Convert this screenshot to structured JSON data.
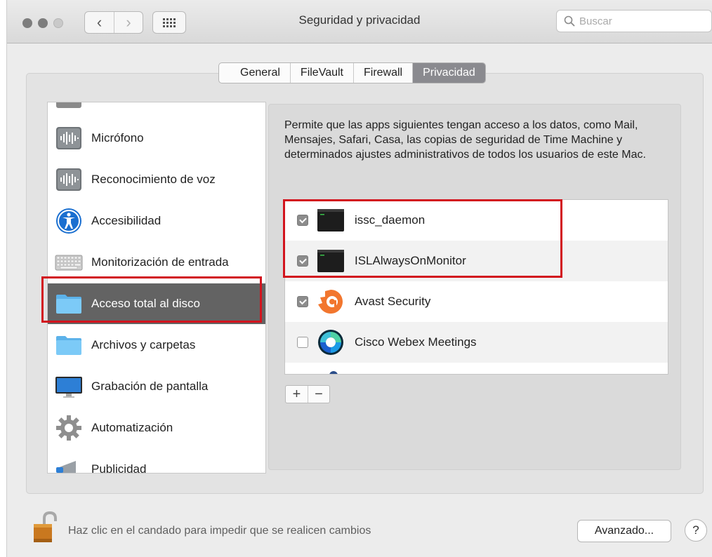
{
  "window": {
    "title": "Seguridad y privacidad",
    "search_placeholder": "Buscar"
  },
  "tabs": [
    {
      "label": "General",
      "active": false
    },
    {
      "label": "FileVault",
      "active": false
    },
    {
      "label": "Firewall",
      "active": false
    },
    {
      "label": "Privacidad",
      "active": true
    }
  ],
  "categories": [
    {
      "label": "Micrófono",
      "icon": "microphone-icon"
    },
    {
      "label": "Reconocimiento de voz",
      "icon": "speech-recognition-icon"
    },
    {
      "label": "Accesibilidad",
      "icon": "accessibility-icon"
    },
    {
      "label": "Monitorización de entrada",
      "icon": "keyboard-icon"
    },
    {
      "label": "Acceso total al disco",
      "icon": "folder-icon",
      "selected": true
    },
    {
      "label": "Archivos y carpetas",
      "icon": "folder-icon"
    },
    {
      "label": "Grabación de pantalla",
      "icon": "display-icon"
    },
    {
      "label": "Automatización",
      "icon": "gear-icon"
    },
    {
      "label": "Publicidad",
      "icon": "megaphone-icon"
    }
  ],
  "description": "Permite que las apps siguientes tengan acceso a los datos, como Mail, Mensajes, Safari, Casa, las copias de seguridad de Time Machine y determinados ajustes administrativos de todos los usuarios de este Mac.",
  "apps": [
    {
      "name": "issc_daemon",
      "checked": true,
      "icon": "terminal-icon"
    },
    {
      "name": "ISLAlwaysOnMonitor",
      "checked": true,
      "icon": "terminal-icon"
    },
    {
      "name": "Avast Security",
      "checked": true,
      "icon": "avast-icon"
    },
    {
      "name": "Cisco Webex Meetings",
      "checked": false,
      "icon": "webex-icon"
    }
  ],
  "list_controls": {
    "add": "+",
    "remove": "−"
  },
  "footer": {
    "lock_text": "Haz clic en el candado para impedir que se realicen cambios",
    "advanced_label": "Avanzado...",
    "help_label": "?"
  },
  "colors": {
    "highlight": "#d2141e",
    "selected_row": "#636363",
    "active_tab": "#8a8a8f"
  }
}
